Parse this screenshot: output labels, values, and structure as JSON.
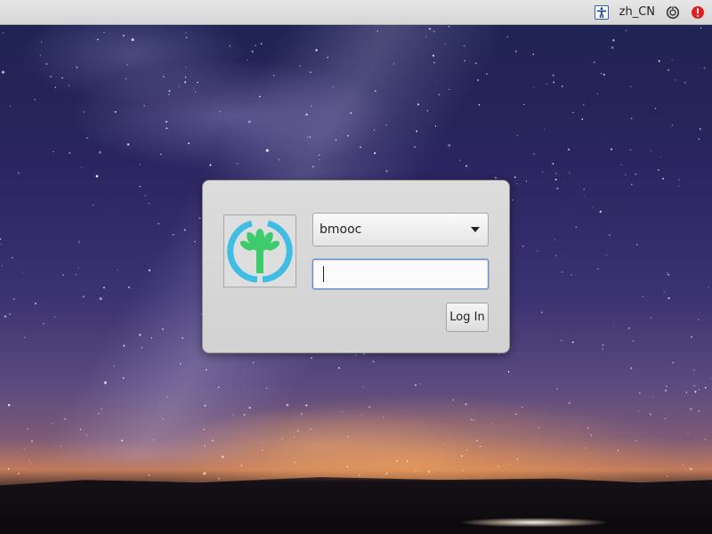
{
  "panel": {
    "accessibility_icon": "accessibility-icon",
    "language": "zh_CN",
    "session_icon": "session-power-icon",
    "alert_icon": "alert-icon"
  },
  "login": {
    "avatar_icon": "palm-tree-logo-icon",
    "username": "bmooc",
    "password_value": "",
    "login_label": "Log In"
  },
  "colors": {
    "panel_bg": "#dddddd",
    "dialog_bg": "#d6d6d6",
    "focus_border": "#5b8fc7",
    "logo_ring": "#3fbde4",
    "logo_tree": "#3dcc6c",
    "alert_red": "#e02020"
  }
}
